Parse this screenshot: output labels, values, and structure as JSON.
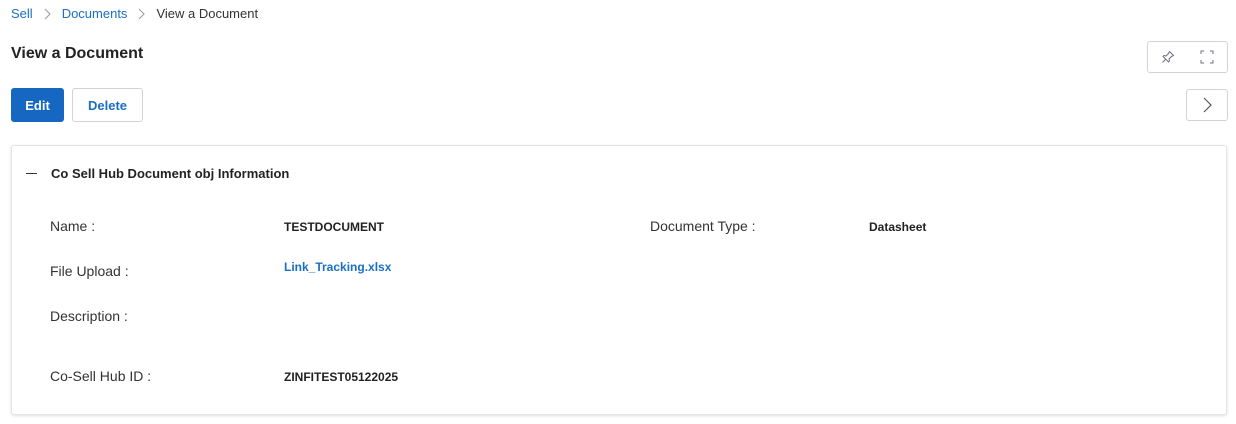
{
  "breadcrumb": {
    "items": [
      {
        "label": "Sell"
      },
      {
        "label": "Documents"
      },
      {
        "label": "View a Document"
      }
    ]
  },
  "page": {
    "title": "View a Document"
  },
  "toolbar": {
    "edit_label": "Edit",
    "delete_label": "Delete"
  },
  "section": {
    "title": "Co Sell Hub Document obj Information",
    "fields": {
      "name": {
        "label": "Name :",
        "value": "TESTDOCUMENT"
      },
      "document_type": {
        "label": "Document Type :",
        "value": "Datasheet"
      },
      "file_upload": {
        "label": "File Upload :",
        "value": "Link_Tracking.xlsx"
      },
      "description": {
        "label": "Description :",
        "value": ""
      },
      "cosell_hub_id": {
        "label": "Co-Sell Hub ID :",
        "value": "ZINFITEST05122025"
      }
    }
  },
  "icons": {
    "pin": "pin-icon",
    "expand": "fullscreen-icon",
    "next": "chevron-right-icon",
    "separator": "chevron-right-icon",
    "collapse": "minus-icon"
  },
  "colors": {
    "primary": "#1667c2",
    "link": "#1a6fc4",
    "border": "#cfd4da"
  }
}
